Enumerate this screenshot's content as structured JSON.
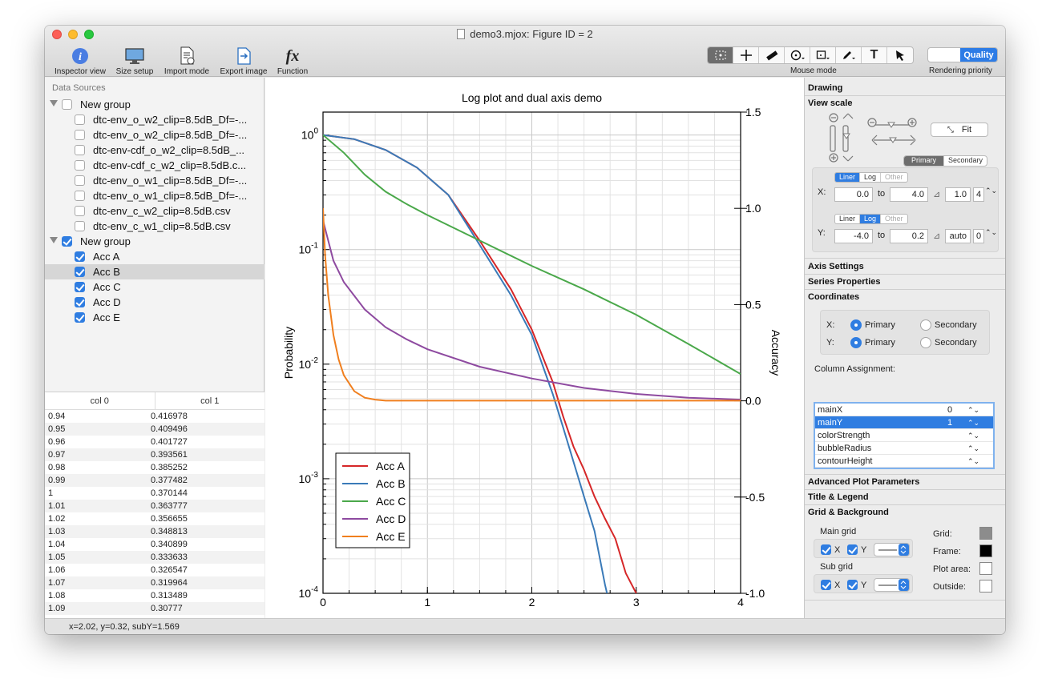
{
  "window": {
    "title": "demo3.mjox: Figure ID = 2"
  },
  "toolbar": {
    "inspector": "Inspector view",
    "size_setup": "Size setup",
    "import_mode": "Import mode",
    "export_image": "Export image",
    "function": "Function",
    "mouse_mode": "Mouse mode",
    "rendering_priority": "Rendering priority",
    "quality": "Quality"
  },
  "left": {
    "title": "Data Sources",
    "groups": [
      {
        "label": "New group",
        "checked": false,
        "items": [
          "dtc-env_o_w2_clip=8.5dB_Df=-...",
          "dtc-env_o_w2_clip=8.5dB_Df=-...",
          "dtc-env-cdf_o_w2_clip=8.5dB_...",
          "dtc-env-cdf_c_w2_clip=8.5dB.c...",
          "dtc-env_o_w1_clip=8.5dB_Df=-...",
          "dtc-env_o_w1_clip=8.5dB_Df=-...",
          "dtc-env_c_w2_clip=8.5dB.csv",
          "dtc-env_c_w1_clip=8.5dB.csv"
        ]
      },
      {
        "label": "New group",
        "checked": true,
        "items": [
          "Acc A",
          "Acc B",
          "Acc C",
          "Acc D",
          "Acc E"
        ]
      }
    ],
    "table": {
      "headers": [
        "col 0",
        "col 1"
      ],
      "rows": [
        [
          "0.94",
          "0.416978"
        ],
        [
          "0.95",
          "0.409496"
        ],
        [
          "0.96",
          "0.401727"
        ],
        [
          "0.97",
          "0.393561"
        ],
        [
          "0.98",
          "0.385252"
        ],
        [
          "0.99",
          "0.377482"
        ],
        [
          "1",
          "0.370144"
        ],
        [
          "1.01",
          "0.363777"
        ],
        [
          "1.02",
          "0.356655"
        ],
        [
          "1.03",
          "0.348813"
        ],
        [
          "1.04",
          "0.340899"
        ],
        [
          "1.05",
          "0.333633"
        ],
        [
          "1.06",
          "0.326547"
        ],
        [
          "1.07",
          "0.319964"
        ],
        [
          "1.08",
          "0.313489"
        ],
        [
          "1.09",
          "0.30777"
        ]
      ]
    }
  },
  "status": "x=2.02, y=0.32, subY=1.569",
  "chart_data": {
    "type": "line",
    "title": "Log plot and dual axis demo",
    "xlabel": "",
    "ylabel": "Probability",
    "y2label": "Accuracy",
    "xlim": [
      0,
      4
    ],
    "ylim": [
      -4,
      0.2
    ],
    "yscale": "log",
    "y2lim": [
      -1.0,
      1.5
    ],
    "xticks": [
      "0",
      "1",
      "2",
      "3",
      "4"
    ],
    "yticks": [
      "10^0",
      "10^-1",
      "10^-2",
      "10^-3",
      "10^-4"
    ],
    "y2ticks": [
      "1.5",
      "1.0",
      "0.5",
      "0.0",
      "-0.5",
      "-1.0"
    ],
    "grid": true,
    "legend": "bottom-left",
    "series": [
      {
        "name": "Acc A",
        "color": "#d62728",
        "x": [
          0,
          0.3,
          0.6,
          0.9,
          1.2,
          1.5,
          1.8,
          2.0,
          2.2,
          2.3,
          2.4,
          2.5,
          2.6,
          2.7,
          2.8,
          2.9,
          3.0
        ],
        "y": [
          1.0,
          0.92,
          0.74,
          0.52,
          0.3,
          0.12,
          0.045,
          0.02,
          0.007,
          0.0035,
          0.0019,
          0.0012,
          0.0007,
          0.00045,
          0.0003,
          0.00015,
          0.0001
        ]
      },
      {
        "name": "Acc B",
        "color": "#3a7ab8",
        "x": [
          0,
          0.3,
          0.6,
          0.9,
          1.2,
          1.5,
          1.8,
          2.0,
          2.2,
          2.3,
          2.4,
          2.5,
          2.6,
          2.7,
          2.72
        ],
        "y": [
          1.0,
          0.92,
          0.74,
          0.52,
          0.3,
          0.11,
          0.04,
          0.018,
          0.0055,
          0.0028,
          0.0014,
          0.0007,
          0.00035,
          0.00012,
          0.0001
        ]
      },
      {
        "name": "Acc C",
        "color": "#4aa84a",
        "x": [
          0,
          0.2,
          0.4,
          0.6,
          0.8,
          1.0,
          1.5,
          2.0,
          2.5,
          3.0,
          3.5,
          4.0
        ],
        "y": [
          1.0,
          0.7,
          0.45,
          0.32,
          0.25,
          0.2,
          0.12,
          0.072,
          0.045,
          0.027,
          0.015,
          0.0082
        ]
      },
      {
        "name": "Acc D",
        "color": "#8e4aa0",
        "x": [
          0,
          0.1,
          0.2,
          0.4,
          0.6,
          0.8,
          1.0,
          1.5,
          2.0,
          2.5,
          3.0,
          3.5,
          4.0
        ],
        "y": [
          0.18,
          0.08,
          0.052,
          0.03,
          0.021,
          0.0165,
          0.0135,
          0.0095,
          0.0075,
          0.0062,
          0.0055,
          0.0051,
          0.0049
        ]
      },
      {
        "name": "Acc E",
        "color": "#f07f1e",
        "x": [
          0,
          0.02,
          0.05,
          0.1,
          0.15,
          0.2,
          0.3,
          0.4,
          0.5,
          0.6,
          1,
          2,
          3,
          4
        ],
        "y": [
          0.23,
          0.09,
          0.04,
          0.018,
          0.011,
          0.008,
          0.0058,
          0.0051,
          0.0049,
          0.0048,
          0.0048,
          0.0048,
          0.0048,
          0.0048
        ]
      }
    ]
  },
  "inspector": {
    "drawing": "Drawing",
    "view_scale": "View scale",
    "fit": "Fit",
    "primary": "Primary",
    "secondary": "Secondary",
    "x_label": "X:",
    "y_label": "Y:",
    "seg": [
      "Liner",
      "Log",
      "Other"
    ],
    "x_from": "0.0",
    "to": "to",
    "x_to": "4.0",
    "x_step": "1.0",
    "x_sub": "4",
    "y_from": "-4.0",
    "y_to": "0.2",
    "y_step": "auto",
    "y_sub": "0",
    "axis_settings": "Axis Settings",
    "series_properties": "Series Properties",
    "coordinates": "Coordinates",
    "coord_x": "X:",
    "coord_y": "Y:",
    "column_assignment": "Column Assignment:",
    "columns": [
      {
        "name": "mainX",
        "value": "0"
      },
      {
        "name": "mainY",
        "value": "1"
      },
      {
        "name": "colorStrength",
        "value": ""
      },
      {
        "name": "bubbleRadius",
        "value": ""
      },
      {
        "name": "contourHeight",
        "value": ""
      }
    ],
    "advanced": "Advanced Plot Parameters",
    "title_legend": "Title & Legend",
    "grid_bg": "Grid & Background",
    "main_grid": "Main grid",
    "sub_grid": "Sub grid",
    "grid_x": "X",
    "grid_y": "Y",
    "grid_lbl": "Grid:",
    "frame_lbl": "Frame:",
    "plot_area_lbl": "Plot area:",
    "outside_lbl": "Outside:",
    "swatch_colors": {
      "grid": "#8c8c8c",
      "frame": "#000000",
      "plot_area": "#ffffff",
      "outside": "#ffffff"
    }
  }
}
